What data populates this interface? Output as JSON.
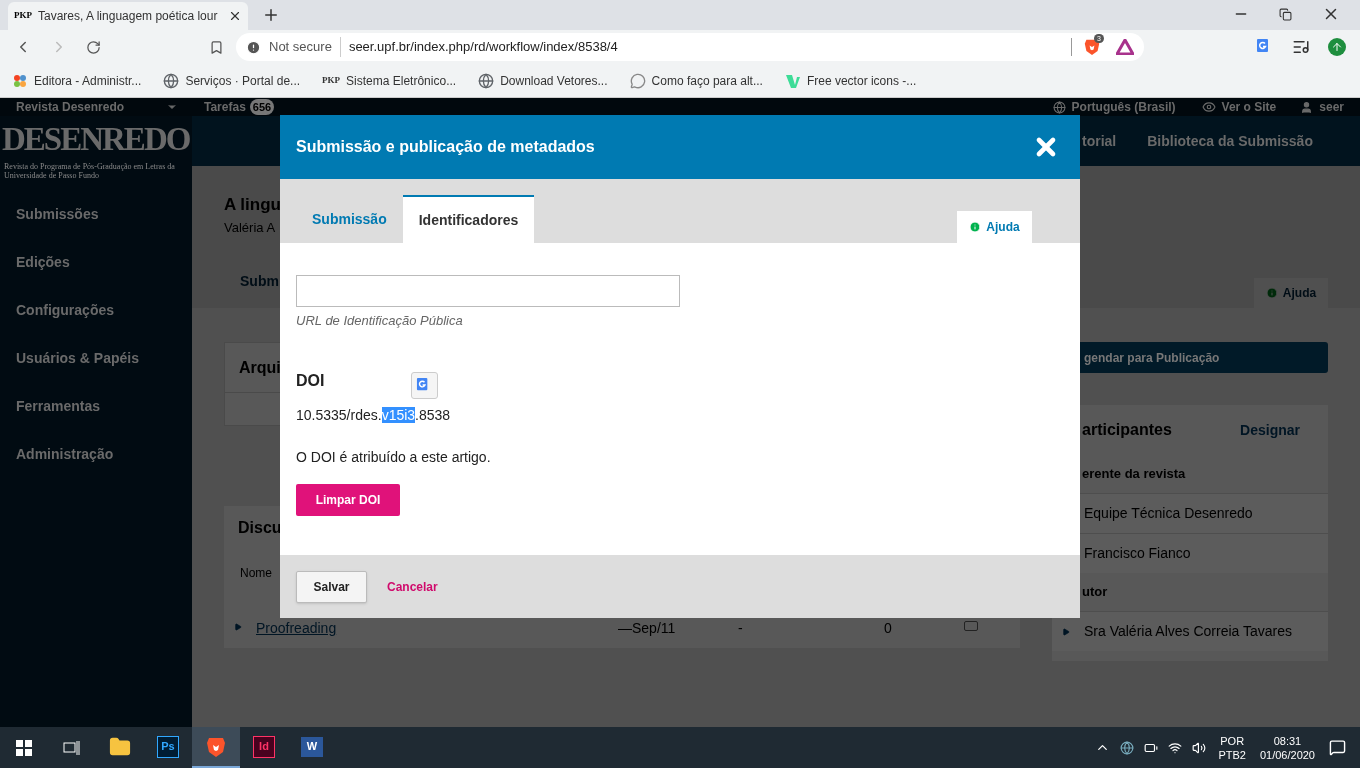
{
  "browser": {
    "tab": {
      "favicon": "PKP",
      "title": "Tavares, A linguagem poética lour"
    },
    "address": {
      "security": "Not secure",
      "url": "seer.upf.br/index.php/rd/workflow/index/8538/4"
    },
    "extension_badge": "3",
    "bookmarks": [
      {
        "kind": "joomla",
        "label": "Editora - Administr..."
      },
      {
        "kind": "globe",
        "label": "Serviços · Portal de..."
      },
      {
        "kind": "pkp",
        "label": "Sistema Eletrônico...",
        "favicon": "PKP"
      },
      {
        "kind": "globe",
        "label": "Download Vetores..."
      },
      {
        "kind": "chat",
        "label": "Como faço para alt..."
      },
      {
        "kind": "vector",
        "label": "Free vector icons -..."
      }
    ]
  },
  "app": {
    "topbar": {
      "journal": "Revista Desenredo",
      "tasks": "Tarefas",
      "tasks_count": "656",
      "language": "Português (Brasil)",
      "view_site": "Ver o Site",
      "user": "seer"
    },
    "logo": {
      "title": "DESENREDO",
      "subtitle": "Revista do Programa de Pós-Graduação em Letras da Universidade de Passo Fundo"
    },
    "sidebar": {
      "items": [
        "Submissões",
        "Edições",
        "Configurações",
        "Usuários & Papéis",
        "Ferramentas",
        "Administração"
      ]
    },
    "nav": [
      "torial",
      "Biblioteca da Submissão"
    ],
    "header": {
      "title": "A lingu",
      "author": "Valéria A",
      "tab": "Subm",
      "help": "Ajuda"
    },
    "cards": [
      {
        "title": "Arqui"
      },
      {
        "title": "Discu",
        "column": "Nome",
        "row": {
          "name": "Proofreading",
          "date": "—Sep/11",
          "column_3": "-",
          "column_4": "0",
          "checked": false
        }
      }
    ],
    "schedule_button": "gendar para Publicação",
    "participants": {
      "title": "articipantes",
      "action": "Designar",
      "groups": [
        {
          "name": "erente da revista",
          "people": [
            "Equipe Técnica Desenredo",
            "Francisco Fianco"
          ]
        },
        {
          "name": "utor",
          "people": [
            "Sra Valéria Alves Correia Tavares"
          ]
        }
      ]
    }
  },
  "modal": {
    "title": "Submissão e publicação de metadados",
    "tabs": [
      {
        "label": "Submissão",
        "selected": false
      },
      {
        "label": "Identificadores",
        "selected": true
      }
    ],
    "help": "Ajuda",
    "url_field": {
      "label": "URL de Identificação Pública"
    },
    "doi": {
      "heading": "DOI",
      "before": "10.5335/rdes.",
      "selected_text": "v15i3",
      "after": ".8538",
      "note": "O DOI é atribuído a este artigo.",
      "clear_button": "Limpar DOI"
    },
    "buttons": {
      "save": "Salvar",
      "cancel": "Cancelar"
    }
  },
  "taskbar": {
    "apps": [
      {
        "kind": "explorer",
        "selected": false
      },
      {
        "kind": "ps",
        "label": "Ps",
        "selected": false
      },
      {
        "kind": "brave",
        "selected": true
      },
      {
        "kind": "id",
        "label": "Id",
        "selected": false
      },
      {
        "kind": "word",
        "label": "W",
        "selected": false
      }
    ],
    "language": "POR",
    "layout": "PTB2",
    "time": "08:31",
    "date": "01/06/2020"
  }
}
